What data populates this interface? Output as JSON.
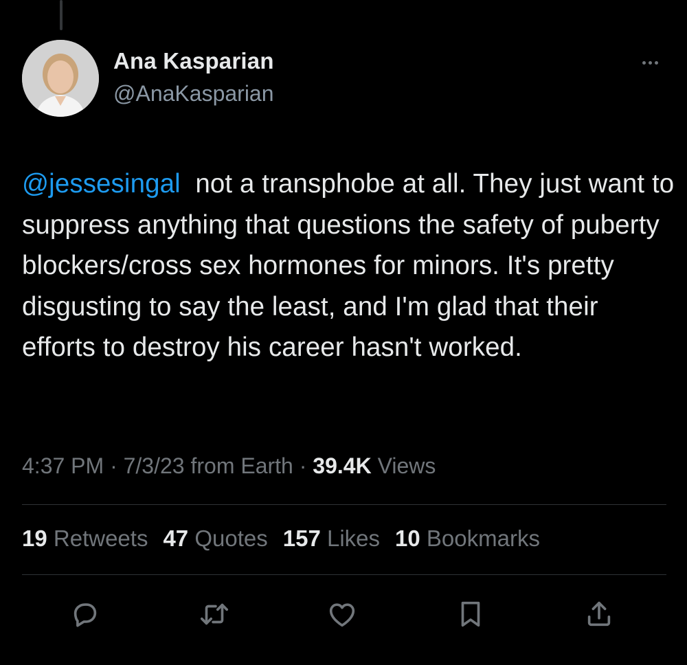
{
  "author": {
    "name": "Ana Kasparian",
    "handle": "@AnaKasparian"
  },
  "tweet": {
    "mention": "@jessesingal",
    "text": "not a transphobe at all. They just want to suppress anything that questions the safety of puberty blockers/cross sex hormones for minors. It's pretty disgusting to say the least, and I'm glad that their efforts to destroy his career hasn't worked."
  },
  "meta": {
    "time": "4:37 PM",
    "date": "7/3/23",
    "source": "from Earth",
    "views_count": "39.4K",
    "views_label": "Views"
  },
  "stats": {
    "retweets_count": "19",
    "retweets_label": "Retweets",
    "quotes_count": "47",
    "quotes_label": "Quotes",
    "likes_count": "157",
    "likes_label": "Likes",
    "bookmarks_count": "10",
    "bookmarks_label": "Bookmarks"
  },
  "icons": {
    "more": "more-horizontal-icon",
    "reply": "reply-icon",
    "retweet": "retweet-icon",
    "like": "heart-icon",
    "bookmark": "bookmark-icon",
    "share": "share-icon"
  },
  "colors": {
    "background": "#000000",
    "text": "#e7e9ea",
    "secondary": "#71767b",
    "link": "#1d9bf0",
    "divider": "#2f3336"
  }
}
